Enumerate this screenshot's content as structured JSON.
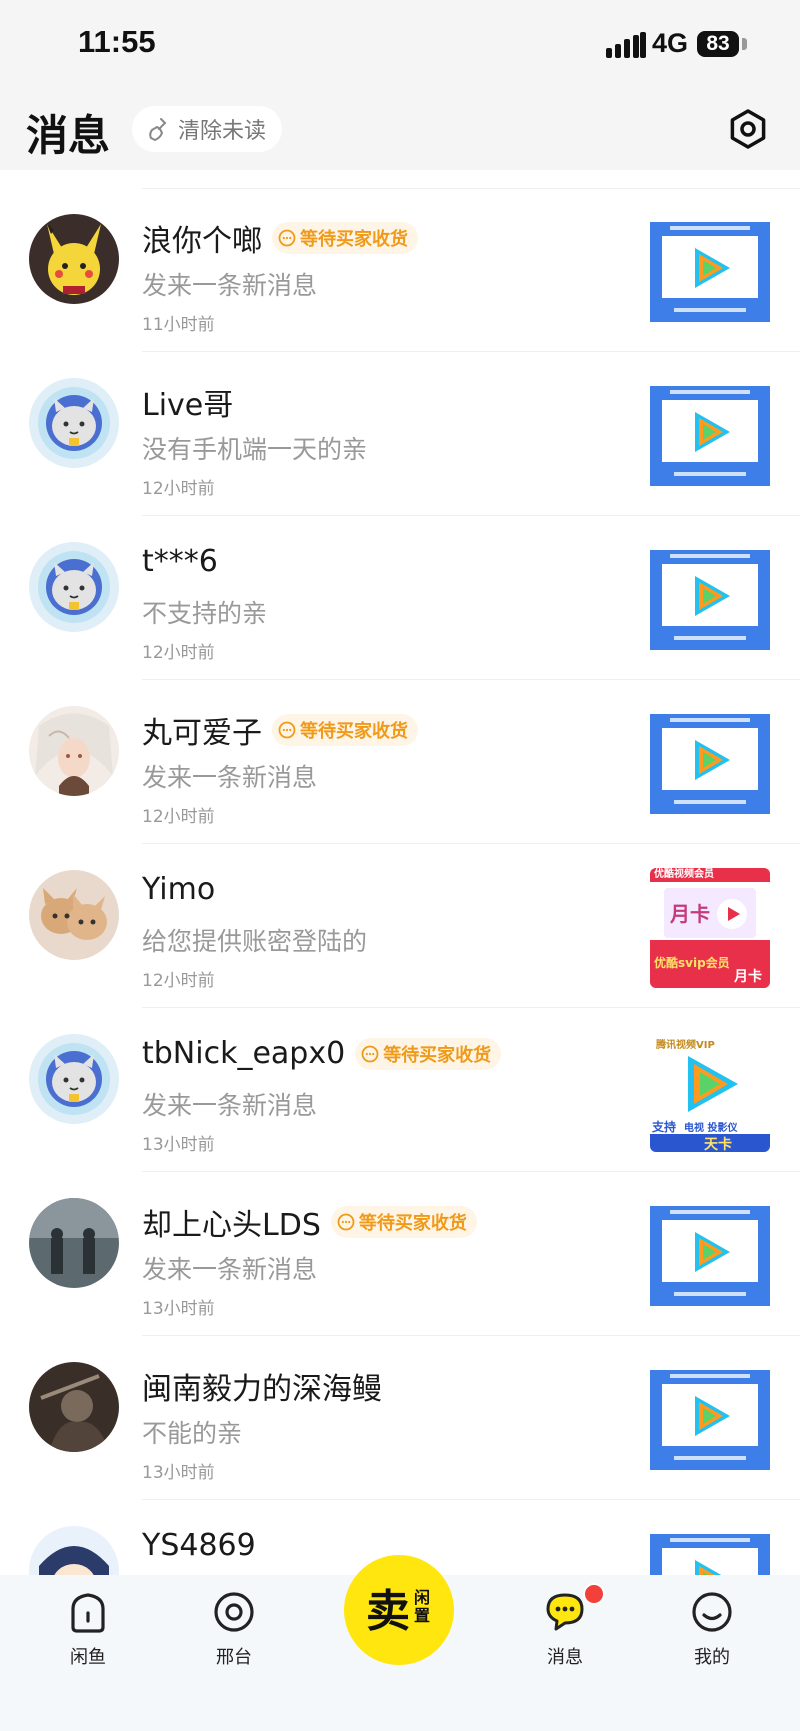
{
  "status_bar": {
    "time": "11:55",
    "network": "4G",
    "battery": "83"
  },
  "header": {
    "title": "消息",
    "clear_unread": "清除未读"
  },
  "conversations": [
    {
      "name": "浪你个啷",
      "badge": "等待买家收货",
      "message": "发来一条新消息",
      "time": "11小时前",
      "thumb": "tencent-video-card"
    },
    {
      "name": "Live哥",
      "badge": "",
      "message": "没有手机端一天的亲",
      "time": "12小时前",
      "thumb": "tencent-video-card"
    },
    {
      "name": "t***6",
      "badge": "",
      "message": "不支持的亲",
      "time": "12小时前",
      "thumb": "tencent-video-card"
    },
    {
      "name": "丸可爱子",
      "badge": "等待买家收货",
      "message": "发来一条新消息",
      "time": "12小时前",
      "thumb": "tencent-video-card"
    },
    {
      "name": "Yimo",
      "badge": "",
      "message": "给您提供账密登陆的",
      "time": "12小时前",
      "thumb": "youku-monthly-card"
    },
    {
      "name": "tbNick_eapx0",
      "badge": "等待买家收货",
      "message": "发来一条新消息",
      "time": "13小时前",
      "thumb": "tencent-vip-day-card"
    },
    {
      "name": "却上心头LDS",
      "badge": "等待买家收货",
      "message": "发来一条新消息",
      "time": "13小时前",
      "thumb": "tencent-video-card"
    },
    {
      "name": "闽南毅力的深海鳗",
      "badge": "",
      "message": "不能的亲",
      "time": "13小时前",
      "thumb": "tencent-video-card"
    },
    {
      "name": "YS4869",
      "badge": "",
      "message": "",
      "time": "",
      "thumb": "tencent-video-card"
    }
  ],
  "thumb_text": {
    "youku_top": "优酷视频会员",
    "youku_month": "月卡",
    "youku_svip": "优酷svip会员",
    "youku_month2": "月卡",
    "tencent_vip": "腾讯视频VIP",
    "tencent_support": "支持",
    "tencent_tv": "电视 投影仪",
    "tencent_day": "天卡"
  },
  "bottom_nav": {
    "home": "闲鱼",
    "market": "邢台",
    "sell_main": "卖",
    "sell_sub": "闲置",
    "messages": "消息",
    "mine": "我的"
  },
  "colors": {
    "brand_yellow": "#ffe60f",
    "badge_orange": "#f09a1a",
    "notify_red": "#f2403a"
  }
}
